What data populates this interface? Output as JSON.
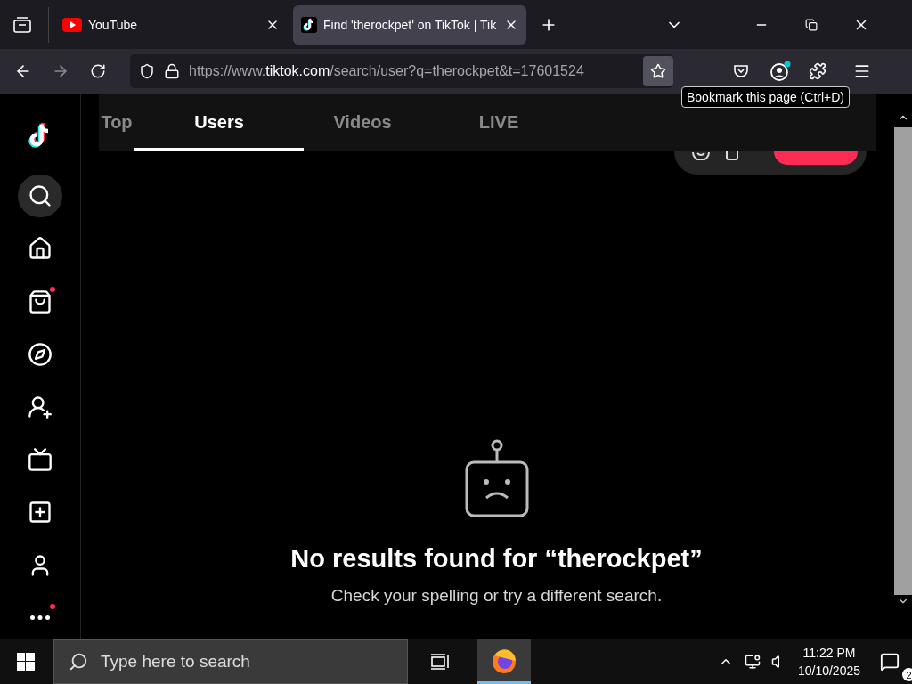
{
  "browser": {
    "tabs": [
      {
        "kind": "youtube",
        "title": "YouTube",
        "selected": false
      },
      {
        "kind": "tiktok",
        "title": "Find 'therockpet' on TikTok | Tik",
        "selected": true
      }
    ],
    "address": {
      "scheme": "https://www.",
      "host": "tiktok.com",
      "path": "/search/user?q=therockpet&t=17601524"
    },
    "tooltip": "Bookmark this page (Ctrl+D)"
  },
  "page": {
    "sidebar": [
      {
        "kind": "search",
        "selected": true,
        "dot": false
      },
      {
        "kind": "home",
        "selected": false,
        "dot": false
      },
      {
        "kind": "shop",
        "selected": false,
        "dot": true
      },
      {
        "kind": "explore",
        "selected": false,
        "dot": false
      },
      {
        "kind": "following",
        "selected": false,
        "dot": false
      },
      {
        "kind": "live",
        "selected": false,
        "dot": false
      },
      {
        "kind": "upload",
        "selected": false,
        "dot": false
      },
      {
        "kind": "profile",
        "selected": false,
        "dot": false
      },
      {
        "kind": "more",
        "selected": false,
        "dot": true
      }
    ],
    "tabs": [
      {
        "label": "Top",
        "selected": false
      },
      {
        "label": "Users",
        "selected": true
      },
      {
        "label": "Videos",
        "selected": false
      },
      {
        "label": "LIVE",
        "selected": false
      }
    ],
    "empty": {
      "title": "No results found for “therockpet”",
      "hint": "Check your spelling or try a different search."
    }
  },
  "taskbar": {
    "search_placeholder": "Type here to search",
    "time": "11:22 PM",
    "date": "10/10/2025",
    "notifications": "2"
  }
}
